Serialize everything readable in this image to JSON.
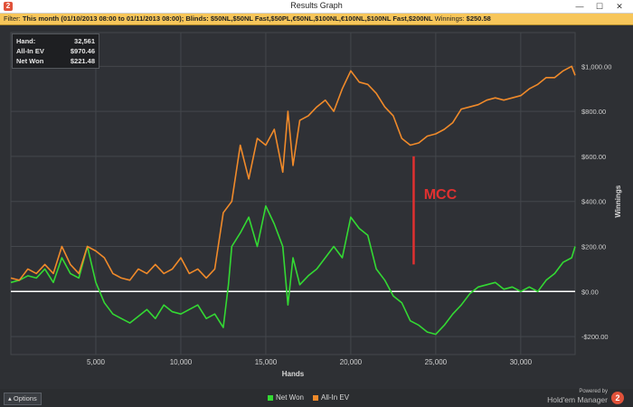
{
  "window": {
    "title": "Results Graph",
    "minimize": "—",
    "maximize": "☐",
    "close": "✕"
  },
  "filter": {
    "label": "Filter:",
    "text": "This month (01/10/2013 08:00 to 01/11/2013 08:00); Blinds: $50NL,$50NL Fast,$50PL,€50NL,$100NL,€100NL,$100NL Fast,$200NL",
    "winnings_label": "Winnings:",
    "winnings_value": "$250.58"
  },
  "stats": [
    {
      "label": "Hand:",
      "value": "32,561"
    },
    {
      "label": "All-In EV",
      "value": "$970.46"
    },
    {
      "label": "Net Won",
      "value": "$221.48"
    }
  ],
  "annotation": {
    "text": "MCC",
    "color": "#e03030"
  },
  "footer": {
    "options_label": "Options",
    "powered_by": "Powered by",
    "brand_name": "Hold'em Manager",
    "brand_mark": "2"
  },
  "colors": {
    "net_won": "#33d933",
    "all_in_ev": "#f08a2a",
    "zero_line": "#ffffff",
    "grid": "#44474c",
    "accent": "#e0523a"
  },
  "chart_data": {
    "type": "line",
    "xlabel": "Hands",
    "ylabel": "Winnings",
    "xlim": [
      0,
      33200
    ],
    "ylim": [
      -280,
      1150
    ],
    "x_ticks": [
      5000,
      10000,
      15000,
      20000,
      25000,
      30000
    ],
    "x_tick_labels": [
      "5,000",
      "10,000",
      "15,000",
      "20,000",
      "25,000",
      "30,000"
    ],
    "y_ticks": [
      -200,
      0,
      200,
      400,
      600,
      800,
      1000
    ],
    "y_tick_labels": [
      "-$200.00",
      "$0.00",
      "$200.00",
      "$400.00",
      "$600.00",
      "$800.00",
      "$1,000.00"
    ],
    "grid": true,
    "legend_position": "bottom-center",
    "series": [
      {
        "name": "Net Won",
        "color": "#33d933",
        "x": [
          0,
          500,
          1000,
          1500,
          2000,
          2500,
          3000,
          3500,
          4000,
          4500,
          5000,
          5500,
          6000,
          6500,
          7000,
          7500,
          8000,
          8500,
          9000,
          9500,
          10000,
          10500,
          11000,
          11500,
          12000,
          12500,
          12800,
          13000,
          13500,
          14000,
          14500,
          15000,
          15500,
          16000,
          16300,
          16600,
          17000,
          17500,
          18000,
          18500,
          19000,
          19500,
          20000,
          20500,
          21000,
          21500,
          22000,
          22500,
          23000,
          23500,
          24000,
          24500,
          25000,
          25500,
          26000,
          26500,
          27000,
          27500,
          28000,
          28500,
          29000,
          29500,
          30000,
          30500,
          31000,
          31500,
          32000,
          32500,
          33000,
          33200
        ],
        "y": [
          40,
          50,
          70,
          60,
          100,
          40,
          150,
          80,
          60,
          200,
          40,
          -50,
          -100,
          -120,
          -140,
          -110,
          -80,
          -120,
          -60,
          -90,
          -100,
          -80,
          -60,
          -120,
          -100,
          -160,
          30,
          200,
          260,
          330,
          200,
          380,
          300,
          200,
          -60,
          150,
          30,
          70,
          100,
          150,
          200,
          150,
          330,
          280,
          250,
          100,
          50,
          -20,
          -50,
          -130,
          -150,
          -180,
          -190,
          -150,
          -100,
          -60,
          -10,
          20,
          30,
          40,
          10,
          20,
          0,
          20,
          0,
          50,
          80,
          130,
          150,
          200
        ]
      },
      {
        "name": "All-In EV",
        "color": "#f08a2a",
        "x": [
          0,
          500,
          1000,
          1500,
          2000,
          2500,
          3000,
          3500,
          4000,
          4500,
          5000,
          5500,
          6000,
          6500,
          7000,
          7500,
          8000,
          8500,
          9000,
          9500,
          10000,
          10500,
          11000,
          11500,
          12000,
          12500,
          13000,
          13500,
          14000,
          14500,
          15000,
          15500,
          16000,
          16300,
          16600,
          17000,
          17500,
          18000,
          18500,
          19000,
          19500,
          20000,
          20500,
          21000,
          21500,
          22000,
          22500,
          23000,
          23500,
          24000,
          24500,
          25000,
          25500,
          26000,
          26500,
          27000,
          27500,
          28000,
          28500,
          29000,
          29500,
          30000,
          30500,
          31000,
          31500,
          32000,
          32500,
          33000,
          33200
        ],
        "y": [
          60,
          50,
          100,
          80,
          120,
          80,
          200,
          120,
          80,
          200,
          180,
          150,
          80,
          60,
          50,
          100,
          80,
          120,
          80,
          100,
          150,
          80,
          100,
          60,
          100,
          350,
          400,
          650,
          500,
          680,
          650,
          720,
          530,
          800,
          560,
          760,
          780,
          820,
          850,
          800,
          900,
          980,
          930,
          920,
          880,
          820,
          780,
          680,
          650,
          660,
          690,
          700,
          720,
          750,
          810,
          820,
          830,
          850,
          860,
          850,
          860,
          870,
          900,
          920,
          950,
          950,
          980,
          1000,
          960
        ]
      }
    ]
  }
}
